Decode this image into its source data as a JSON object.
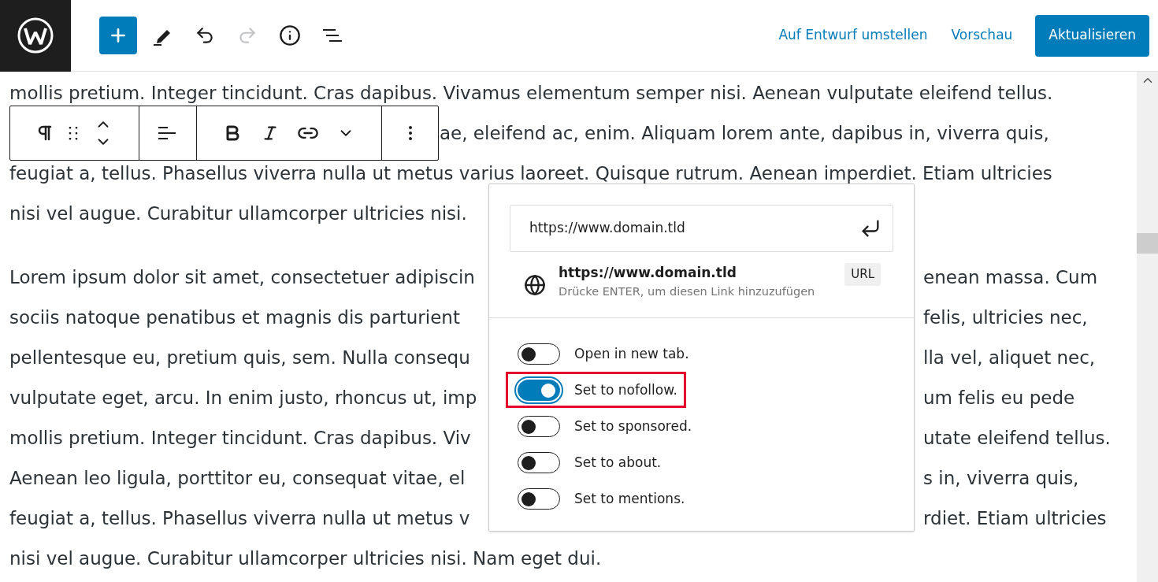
{
  "header": {
    "tools": [
      {
        "kind": "inserter",
        "disabled": false
      },
      {
        "kind": "edit",
        "disabled": false
      },
      {
        "kind": "undo",
        "disabled": false
      },
      {
        "kind": "redo",
        "disabled": true
      },
      {
        "kind": "details",
        "disabled": false
      },
      {
        "kind": "list_view",
        "disabled": false
      }
    ],
    "actions": [
      {
        "label": "Auf Entwurf umstellen",
        "kind": "link"
      },
      {
        "label": "Vorschau",
        "kind": "link"
      },
      {
        "label": "Aktualisieren",
        "kind": "primary"
      }
    ]
  },
  "paragraphs": [
    {
      "lines": [
        {
          "kind": "full",
          "left": "mollis pretium. Integer tincidunt. Cras dapibus. Vivamus elementum semper nisi. Aenean vulputate eleifend tellus."
        },
        {
          "kind": "after_toolbar",
          "left": "ae, eleifend ac, enim. Aliquam lorem ante, dapibus in, viverra quis,"
        },
        {
          "kind": "full",
          "left": "feugiat a, tellus. Phasellus viverra nulla ut metus varius laoreet. Quisque rutrum. Aenean imperdiet. Etiam ultricies"
        },
        {
          "kind": "split",
          "left": "nisi vel augue. Curabitur ullamcorper ultricies nisi."
        }
      ]
    },
    {
      "lines": [
        {
          "kind": "split",
          "left": "Lorem ipsum dolor sit amet, consectetuer adipiscin",
          "right": "enean massa. Cum"
        },
        {
          "kind": "split",
          "left": "sociis natoque penatibus et magnis dis parturient",
          "right": "felis, ultricies nec,"
        },
        {
          "kind": "split",
          "left": "pellentesque eu, pretium quis, sem. Nulla consequ",
          "right": "lla vel, aliquet nec,"
        },
        {
          "kind": "split",
          "left": "vulputate eget, arcu. In enim justo, rhoncus ut, imp",
          "right": "um felis eu pede"
        },
        {
          "kind": "split",
          "left": "mollis pretium. Integer tincidunt. Cras dapibus. Viv",
          "right": "utate eleifend tellus."
        },
        {
          "kind": "split",
          "left": "Aenean leo ligula, porttitor eu, consequat vitae, el",
          "right": "s in, viverra quis,"
        },
        {
          "kind": "split",
          "left": "feugiat a, tellus. Phasellus viverra nulla ut metus v",
          "right": "rdiet. Etiam ultricies"
        },
        {
          "kind": "full",
          "left": "nisi vel augue. Curabitur ullamcorper ultricies nisi. Nam eget dui."
        }
      ]
    }
  ],
  "link_popover": {
    "url_field": {
      "value": "https://www.domain.tld"
    },
    "suggestion": {
      "title": "https://www.domain.tld",
      "hint": "Drücke ENTER, um diesen Link hinzuzufügen",
      "badge": "URL"
    },
    "toggles": [
      {
        "label": "Open in new tab.",
        "on": false,
        "highlighted": false
      },
      {
        "label": "Set to nofollow.",
        "on": true,
        "highlighted": true
      },
      {
        "label": "Set to sponsored.",
        "on": false,
        "highlighted": false
      },
      {
        "label": "Set to about.",
        "on": false,
        "highlighted": false
      },
      {
        "label": "Set to mentions.",
        "on": false,
        "highlighted": false
      }
    ]
  }
}
